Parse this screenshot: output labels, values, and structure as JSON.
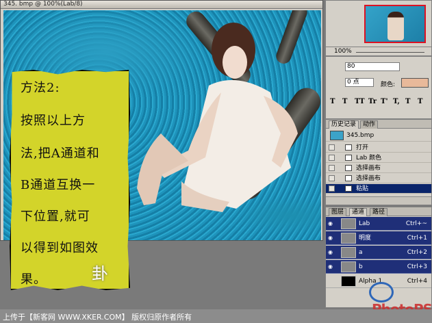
{
  "document": {
    "title": "345. bmp @ 100%(Lab/8)"
  },
  "note": {
    "lines": [
      "方法2:",
      "按照以上方",
      "法,把A通道和",
      "B通道互换一",
      "下位置,就可",
      "以得到如图效",
      "果。"
    ],
    "logo_text": "卦"
  },
  "navigator": {
    "zoom": "100%"
  },
  "character": {
    "size": "80",
    "tracking": "0 点",
    "color_label": "颜色:",
    "color": "#e8b99a",
    "style_buttons": [
      "T",
      "T",
      "TT",
      "Tr",
      "T'",
      "T,",
      "T",
      "T"
    ]
  },
  "history": {
    "tabs": [
      "历史记录",
      "动作"
    ],
    "snapshot": "345.bmp",
    "items": [
      "打开",
      "Lab 颜色",
      "选择画布",
      "选择画布",
      "粘贴"
    ],
    "selected_index": 4
  },
  "channels": {
    "tabs": [
      "图层",
      "通道",
      "路径"
    ],
    "rows": [
      {
        "name": "Lab",
        "shortcut": "Ctrl+~"
      },
      {
        "name": "明度",
        "shortcut": "Ctrl+1"
      },
      {
        "name": "a",
        "shortcut": "Ctrl+2"
      },
      {
        "name": "b",
        "shortcut": "Ctrl+3"
      },
      {
        "name": "Alpha 1",
        "shortcut": "Ctrl+4"
      }
    ]
  },
  "footer": {
    "text": "上传于【新客网 WWW.XKER.COM】 版权归原作者所有",
    "brand": "PhotoPS"
  },
  "colors": {
    "selection": "#0a246a",
    "channel_bg": "#1f2f78",
    "note_bg": "#d3d42a",
    "water": "#1e93bb"
  }
}
